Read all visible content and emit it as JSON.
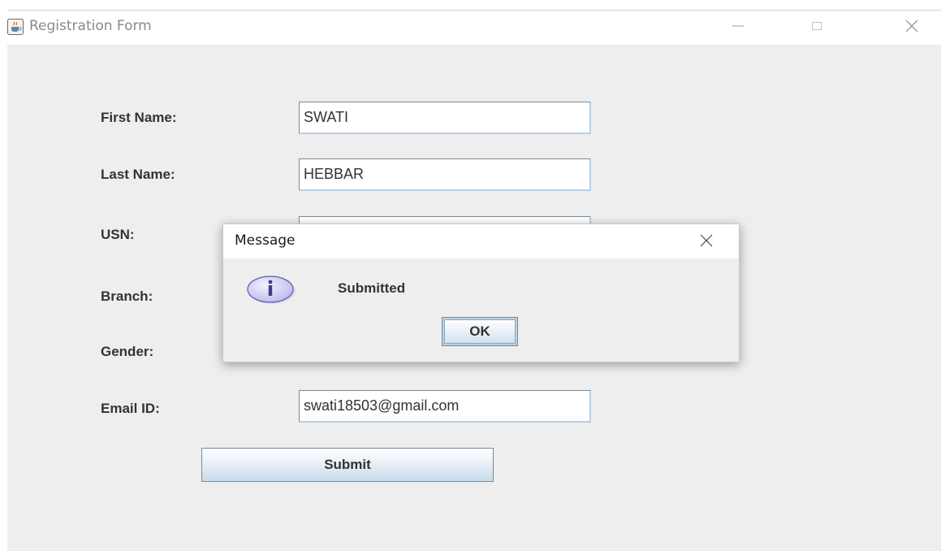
{
  "window": {
    "title": "Registration Form",
    "icon": "java-coffee-icon",
    "controls": [
      "minimize-icon",
      "maximize-icon",
      "close-icon"
    ]
  },
  "form": {
    "fields": [
      {
        "label": "First Name:",
        "value": "SWATI"
      },
      {
        "label": "Last Name:",
        "value": "HEBBAR"
      },
      {
        "label": "USN:",
        "value": ""
      },
      {
        "label": "Branch:",
        "value": ""
      },
      {
        "label": "Gender:",
        "value": ""
      },
      {
        "label": "Email ID:",
        "value": "swati18503@gmail.com"
      }
    ],
    "submit_label": "Submit"
  },
  "dialog": {
    "title": "Message",
    "message": "Submitted",
    "ok_label": "OK",
    "icon": "info-icon"
  },
  "colors": {
    "window_bg": "#eeeeee",
    "button_border": "#7a8a99",
    "button_gradient_end": "#c9dbeb",
    "info_icon_fill": "#c8c8f0",
    "info_icon_stroke": "#5a5ab0"
  }
}
